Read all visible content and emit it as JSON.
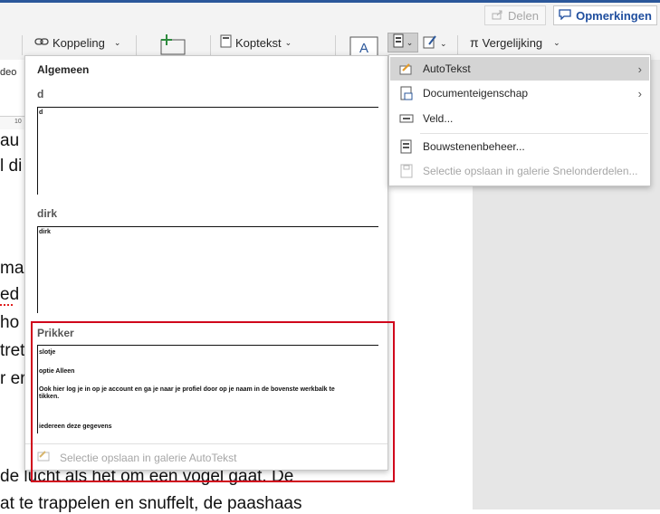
{
  "topbar": {
    "share_label": "Delen",
    "comments_label": "Opmerkingen"
  },
  "ribbon": {
    "link_label": "Koppeling",
    "header_label": "Koptekst",
    "compare_label": "Vergelijking",
    "left_clipped_label": "deo"
  },
  "ruler": {
    "mark": "10"
  },
  "document": {
    "lines": [
      "au",
      "l di",
      "ma",
      "ed",
      "ho",
      "tret",
      "r er",
      "de lucht als het om een vogel gaat. De",
      "at te trappelen en snuffelt, de paashaas"
    ]
  },
  "gallery": {
    "header": "Algemeen",
    "entries": [
      {
        "title": "d",
        "preview": [
          "d"
        ]
      },
      {
        "title": "dirk",
        "preview": [
          "dirk"
        ]
      },
      {
        "title": "Prikker",
        "preview": [
          "slotje",
          "optie Alleen",
          "Ook hier log je in op je account en ga je naar je profiel door op je naam in de bovenste werkbalk te tikken.",
          "iedereen deze gegevens"
        ]
      }
    ],
    "footer_label": "Selectie opslaan in galerie AutoTekst"
  },
  "submenu": {
    "items": [
      {
        "label": "AutoTekst",
        "icon": "autotext-icon",
        "has_submenu": true,
        "highlighted": true,
        "disabled": false
      },
      {
        "label": "Documenteigenschap",
        "icon": "document-property-icon",
        "has_submenu": true,
        "highlighted": false,
        "disabled": false
      },
      {
        "label": "Veld...",
        "icon": "field-icon",
        "has_submenu": false,
        "highlighted": false,
        "disabled": false
      },
      {
        "label": "Bouwstenenbeheer...",
        "icon": "building-blocks-icon",
        "has_submenu": false,
        "highlighted": false,
        "disabled": false
      },
      {
        "label": "Selectie opslaan in galerie Snelonderdelen...",
        "icon": "save-selection-icon",
        "has_submenu": false,
        "highlighted": false,
        "disabled": true
      }
    ]
  },
  "colors": {
    "accent": "#2b579a",
    "highlight_box": "#d0021b",
    "comments_text": "#1f4e9e"
  }
}
